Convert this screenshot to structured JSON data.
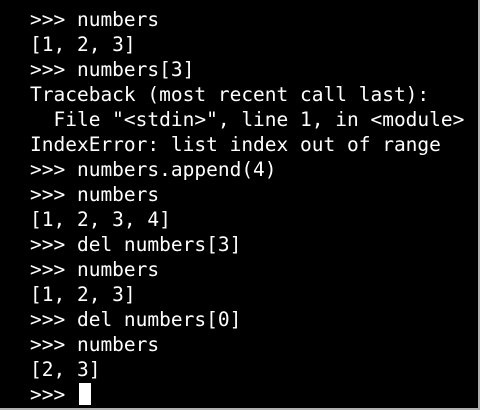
{
  "terminal": {
    "lines": [
      ">>> numbers",
      "[1, 2, 3]",
      ">>> numbers[3]",
      "Traceback (most recent call last):",
      "  File \"<stdin>\", line 1, in <module>",
      "IndexError: list index out of range",
      ">>> numbers.append(4)",
      ">>> numbers",
      "[1, 2, 3, 4]",
      ">>> del numbers[3]",
      ">>> numbers",
      "[1, 2, 3]",
      ">>> del numbers[0]",
      ">>> numbers",
      "[2, 3]"
    ],
    "prompt": ">>> "
  },
  "colors": {
    "background": "#000000",
    "foreground": "#ffffff"
  }
}
